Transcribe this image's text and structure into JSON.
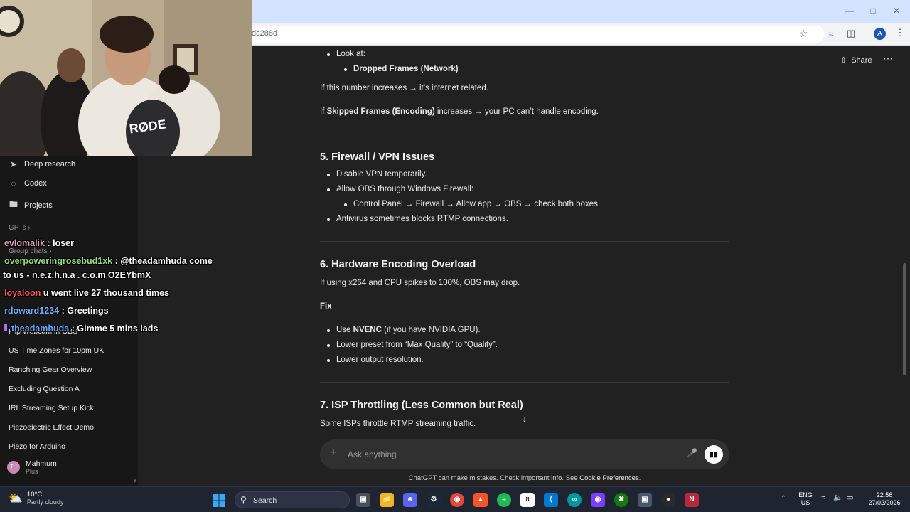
{
  "browser": {
    "url_fragment": "dc288d",
    "profile_initial": "A"
  },
  "sidebar": {
    "nav": [
      {
        "icon": "telescope-icon",
        "label": "Deep research"
      },
      {
        "icon": "codex-icon",
        "label": "Codex"
      },
      {
        "icon": "folder-icon",
        "label": "Projects"
      }
    ],
    "gpts_label": "GPTs",
    "group_chats_label": "Group chats",
    "chats": [
      "Flip Webcam in OBS",
      "US Time Zones for 10pm UK",
      "Ranching Gear Overview",
      "Excluding Question A",
      "IRL Streaming Setup Kick",
      "Piezoelectric Effect Demo",
      "Piezo for Arduino"
    ],
    "user": {
      "initials": "TH",
      "name": "Mahmum",
      "plan": "Plus"
    }
  },
  "header": {
    "share_label": "Share"
  },
  "content": {
    "look_at": "Look at:",
    "dropped_frames": "Dropped Frames (Network)",
    "internet_line": "If this number increases → it’s internet related.",
    "skipped_prefix": "If ",
    "skipped_bold": "Skipped Frames (Encoding)",
    "skipped_suffix": " increases → your PC can’t handle encoding.",
    "h5": "5. Firewall / VPN Issues",
    "fw1": "Disable VPN temporarily.",
    "fw2": "Allow OBS through Windows Firewall:",
    "fw2a": "Control Panel → Firewall → Allow app → OBS → check both boxes.",
    "fw3": "Antivirus sometimes blocks RTMP connections.",
    "h6": "6. Hardware Encoding Overload",
    "enc_intro": "If using x264 and CPU spikes to 100%, OBS may drop.",
    "fix": "Fix",
    "fix1_prefix": "Use ",
    "fix1_bold": "NVENC",
    "fix1_suffix": " (if you have NVIDIA GPU).",
    "fix2": "Lower preset from “Max Quality” to “Quality”.",
    "fix3": "Lower output resolution.",
    "h7": "7. ISP Throttling (Less Common but Real)",
    "isp": "Some ISPs throttle RTMP streaming traffic."
  },
  "composer": {
    "placeholder": "Ask anything"
  },
  "disclaimer": {
    "text": "ChatGPT can make mistakes. Check important info. See ",
    "link": "Cookie Preferences",
    "end": "."
  },
  "stream_chat": [
    {
      "user": "evlomalik",
      "color": "#e8a0c8",
      "msg": " : loser"
    },
    {
      "user": "overpoweringrosebud1xk",
      "color": "#8ee07a",
      "msg": " : @theadamhuda come"
    },
    {
      "user": "",
      "color": "#ffffff",
      "msg": "to us - n.e.z.h.n.a . c.o.m O2EYbmX"
    },
    {
      "user": "loyaloon",
      "color": "#ff4d4d",
      "msg": " u went live 27 thousand times"
    },
    {
      "user": "rdoward1234",
      "color": "#6ab0ff",
      "msg": " : Greetings"
    },
    {
      "user": "theadamhuda",
      "color": "#5fa8ff",
      "msg": " : Gimme 5 mins lads"
    }
  ],
  "taskbar": {
    "temp": "10°C",
    "weather": "Partly cloudy",
    "search": "Search",
    "lang_top": "ENG",
    "lang_bottom": "US",
    "time": "22:56",
    "date": "27/02/2026"
  },
  "colors": {
    "bg": "#212121",
    "sidebar": "#171717",
    "accent": "#d3e3fd"
  }
}
